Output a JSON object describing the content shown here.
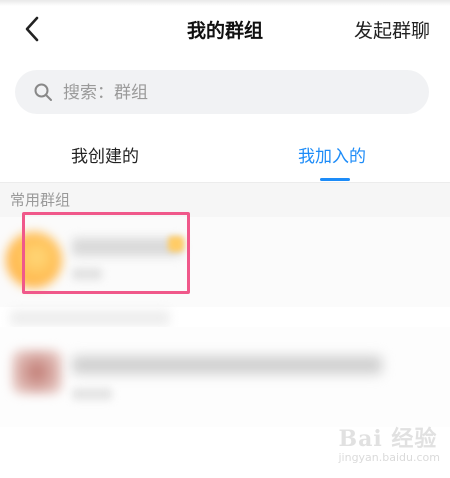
{
  "nav": {
    "title": "我的群组",
    "action_label": "发起群聊",
    "back_icon": "chevron-left-icon"
  },
  "search": {
    "placeholder": "搜索：群组",
    "value": "",
    "icon": "search-icon"
  },
  "tabs": [
    {
      "label": "我创建的",
      "active": false
    },
    {
      "label": "我加入的",
      "active": true
    }
  ],
  "section": {
    "label": "常用群组"
  },
  "colors": {
    "accent": "#1d8cf8",
    "highlight": "#f0588a",
    "section_bg": "#f6f6f6"
  },
  "watermark": {
    "brand": "Bai 经验",
    "sub": "jingyan.baidu.com"
  }
}
